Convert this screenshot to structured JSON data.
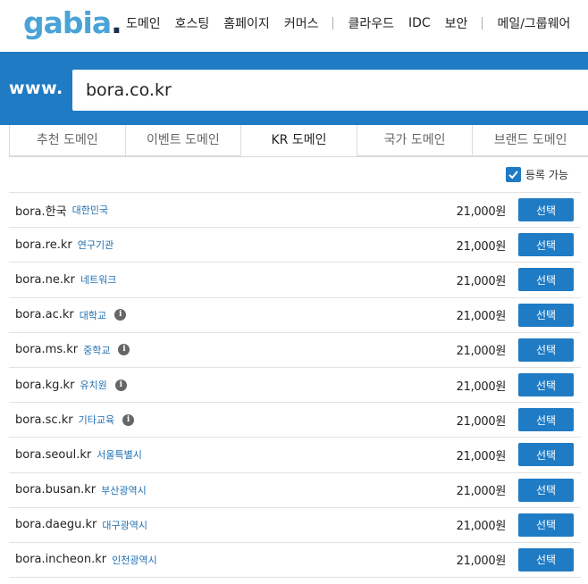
{
  "header": {
    "logo_text": "gabia",
    "logo_dot": ".",
    "nav": [
      "도메인",
      "호스팅",
      "홈페이지",
      "커머스",
      "클라우드",
      "IDC",
      "보안",
      "메일/그룹웨어"
    ]
  },
  "search": {
    "prefix": "www.",
    "value": "bora.co.kr"
  },
  "tabs": [
    {
      "label": "추천 도메인",
      "active": false
    },
    {
      "label": "이벤트 도메인",
      "active": false
    },
    {
      "label": "KR 도메인",
      "active": true
    },
    {
      "label": "국가 도메인",
      "active": false
    },
    {
      "label": "브랜드 도메인",
      "active": false
    }
  ],
  "filter": {
    "label": "등록 가능",
    "checked": true
  },
  "select_label": "선택",
  "rows": [
    {
      "domain": "bora.한국",
      "desc": "대한민국",
      "info": false,
      "price": "21,000원"
    },
    {
      "domain": "bora.re.kr",
      "desc": "연구기관",
      "info": false,
      "price": "21,000원"
    },
    {
      "domain": "bora.ne.kr",
      "desc": "네트워크",
      "info": false,
      "price": "21,000원"
    },
    {
      "domain": "bora.ac.kr",
      "desc": "대학교",
      "info": true,
      "price": "21,000원"
    },
    {
      "domain": "bora.ms.kr",
      "desc": "중학교",
      "info": true,
      "price": "21,000원"
    },
    {
      "domain": "bora.kg.kr",
      "desc": "유치원",
      "info": true,
      "price": "21,000원"
    },
    {
      "domain": "bora.sc.kr",
      "desc": "기타교육",
      "info": true,
      "price": "21,000원"
    },
    {
      "domain": "bora.seoul.kr",
      "desc": "서울특별시",
      "info": false,
      "price": "21,000원"
    },
    {
      "domain": "bora.busan.kr",
      "desc": "부산광역시",
      "info": false,
      "price": "21,000원"
    },
    {
      "domain": "bora.daegu.kr",
      "desc": "대구광역시",
      "info": false,
      "price": "21,000원"
    },
    {
      "domain": "bora.incheon.kr",
      "desc": "인천광역시",
      "info": false,
      "price": "21,000원"
    }
  ],
  "info_glyph": "i",
  "colors": {
    "brand_blue": "#1f7bc4",
    "logo_blue": "#4aa3d6",
    "desc_blue": "#1f6fb2"
  }
}
